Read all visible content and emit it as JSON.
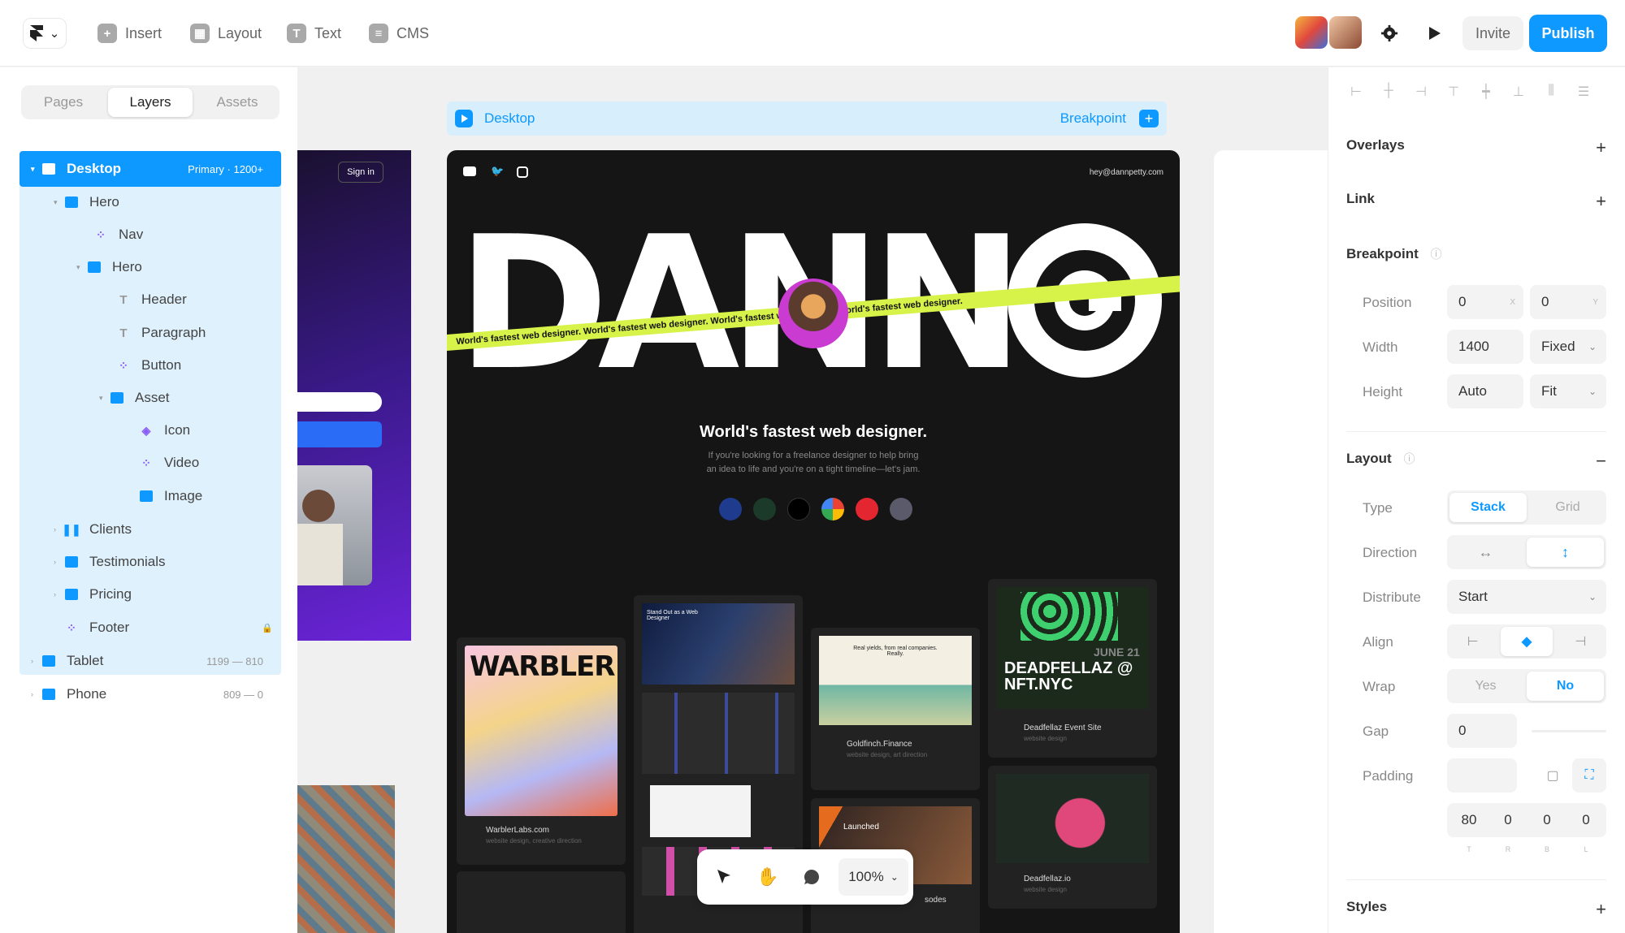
{
  "topbar": {
    "insert": "Insert",
    "layout": "Layout",
    "text": "Text",
    "cms": "CMS",
    "invite": "Invite",
    "publish": "Publish"
  },
  "left_tabs": [
    "Pages",
    "Layers",
    "Assets"
  ],
  "layers": [
    {
      "name": "Desktop",
      "meta": "Primary · 1200+"
    },
    {
      "name": "Hero"
    },
    {
      "name": "Nav"
    },
    {
      "name": "Hero"
    },
    {
      "name": "Header"
    },
    {
      "name": "Paragraph"
    },
    {
      "name": "Button"
    },
    {
      "name": "Asset"
    },
    {
      "name": "Icon"
    },
    {
      "name": "Video"
    },
    {
      "name": "Image"
    },
    {
      "name": "Clients"
    },
    {
      "name": "Testimonials"
    },
    {
      "name": "Pricing"
    },
    {
      "name": "Footer"
    },
    {
      "name": "Tablet",
      "meta": "1199 — 810"
    },
    {
      "name": "Phone",
      "meta": "809 — 0"
    }
  ],
  "canvas": {
    "breakpoint_title": "Desktop",
    "breakpoint_add": "Breakpoint",
    "tablet_signin": "Sign in",
    "site": {
      "email": "hey@dannpetty.com",
      "logo": "DANNO",
      "ribbon": "World's fastest web designer.   World's fastest web designer.   World's fastest web designer.   World's fastest web designer.",
      "headline": "World's fastest web designer.",
      "subtext_1": "If you're looking for a freelance designer to help bring",
      "subtext_2": "an idea to life and you're on a tight timeline—let's jam.",
      "cards": [
        {
          "title": "WARBLER",
          "caption": "WarblerLabs.com",
          "sub": "website design, creative direction"
        },
        {
          "title": "Stand Out as a Web Designer",
          "caption": "",
          "sub": ""
        },
        {
          "title": "Real yields, from real companies. Really.",
          "caption": "Goldfinch.Finance",
          "sub": "website design, art direction"
        },
        {
          "title": "DEADFELLAZ @ NFT.NYC",
          "date": "JUNE 21",
          "caption": "Deadfellaz Event Site",
          "sub": "website design"
        },
        {
          "title": "Launched",
          "caption": "sodes",
          "sub": ""
        },
        {
          "title": "",
          "caption": "Deadfellaz.io",
          "sub": "website design"
        }
      ]
    },
    "zoom": "100%"
  },
  "right_panel": {
    "overlays": "Overlays",
    "link": "Link",
    "breakpoint": "Breakpoint",
    "position_label": "Position",
    "position_x": "0",
    "position_x_suffix": "X",
    "position_y": "0",
    "position_y_suffix": "Y",
    "width_label": "Width",
    "width_value": "1400",
    "width_mode": "Fixed",
    "height_label": "Height",
    "height_value": "Auto",
    "height_mode": "Fit",
    "layout": "Layout",
    "type_label": "Type",
    "type_options": [
      "Stack",
      "Grid"
    ],
    "type_selected": "Stack",
    "direction_label": "Direction",
    "distribute_label": "Distribute",
    "distribute_value": "Start",
    "align_label": "Align",
    "wrap_label": "Wrap",
    "wrap_options": [
      "Yes",
      "No"
    ],
    "wrap_selected": "No",
    "gap_label": "Gap",
    "gap_value": "0",
    "padding_label": "Padding",
    "padding_values": [
      "80",
      "0",
      "0",
      "0"
    ],
    "padding_sides": [
      "T",
      "R",
      "B",
      "L"
    ],
    "styles": "Styles"
  },
  "colors": {
    "accent": "#0d99ff",
    "ribbon": "#d7f34a",
    "site_bg": "#151515"
  }
}
